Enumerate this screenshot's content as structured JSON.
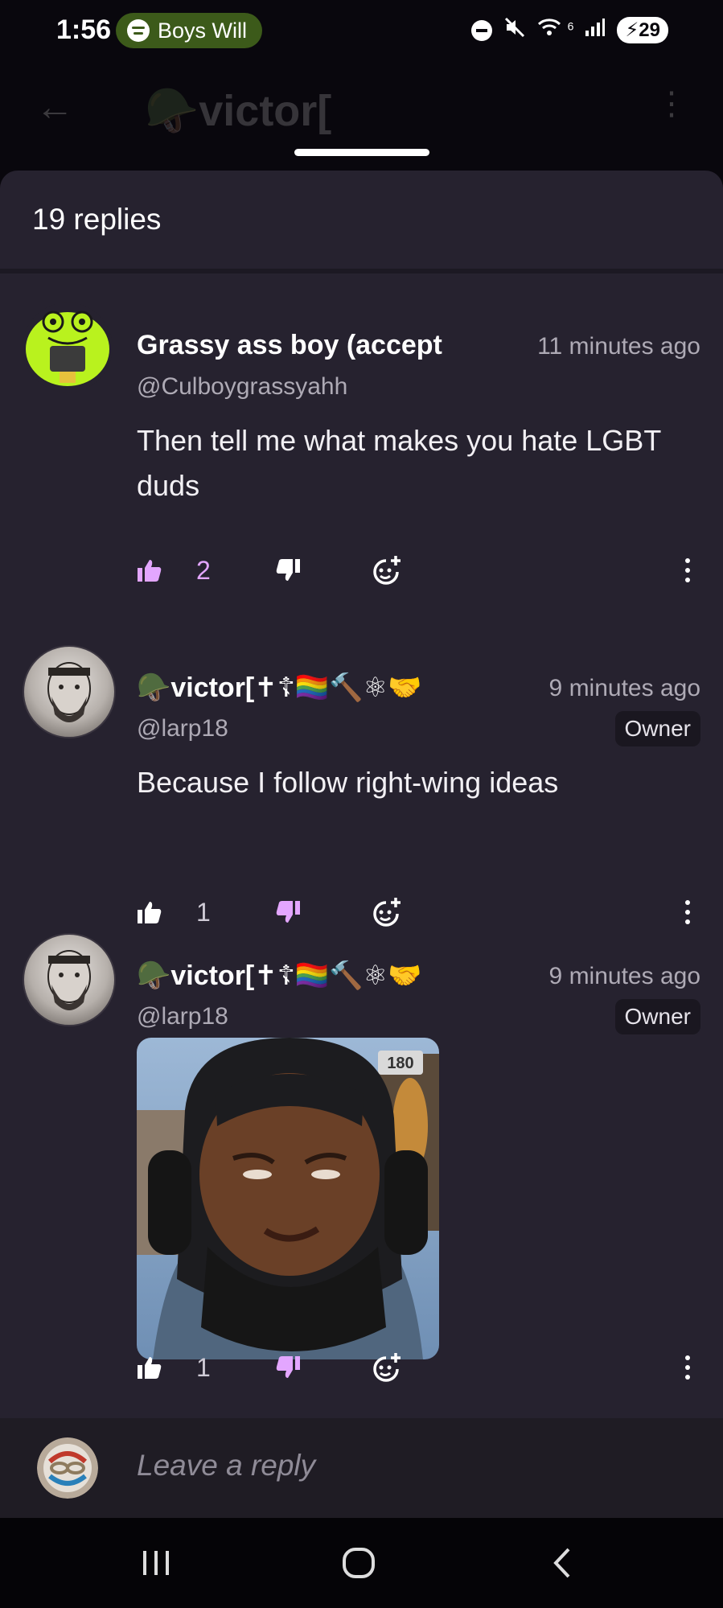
{
  "status_bar": {
    "time": "1:56",
    "media_track": "Boys Will",
    "signal_label": "6",
    "battery": "29"
  },
  "background_header": {
    "title": "victor["
  },
  "sheet": {
    "replies_count": "19 replies"
  },
  "comments": [
    {
      "author": "Grassy ass boy (accept",
      "handle": "@Culboygrassyahh",
      "time": "11 minutes ago",
      "text": "Then tell me what makes you hate LGBT duds",
      "likes": "2",
      "liked": true,
      "disliked": false
    },
    {
      "author": "victor[",
      "handle": "@larp18",
      "badge": "Owner",
      "time": "9 minutes ago",
      "text": "Because I follow right-wing ideas",
      "likes": "1",
      "liked": false,
      "disliked": true
    },
    {
      "author": "victor[",
      "handle": "@larp18",
      "badge": "Owner",
      "time": "9 minutes ago",
      "media_badge": "180",
      "likes": "1"
    }
  ],
  "reply_bar": {
    "placeholder": "Leave a reply"
  },
  "colors": {
    "accent_purple": "#e3a6ff",
    "sheet_bg": "#26222f",
    "frog_green": "#b9f21e"
  }
}
